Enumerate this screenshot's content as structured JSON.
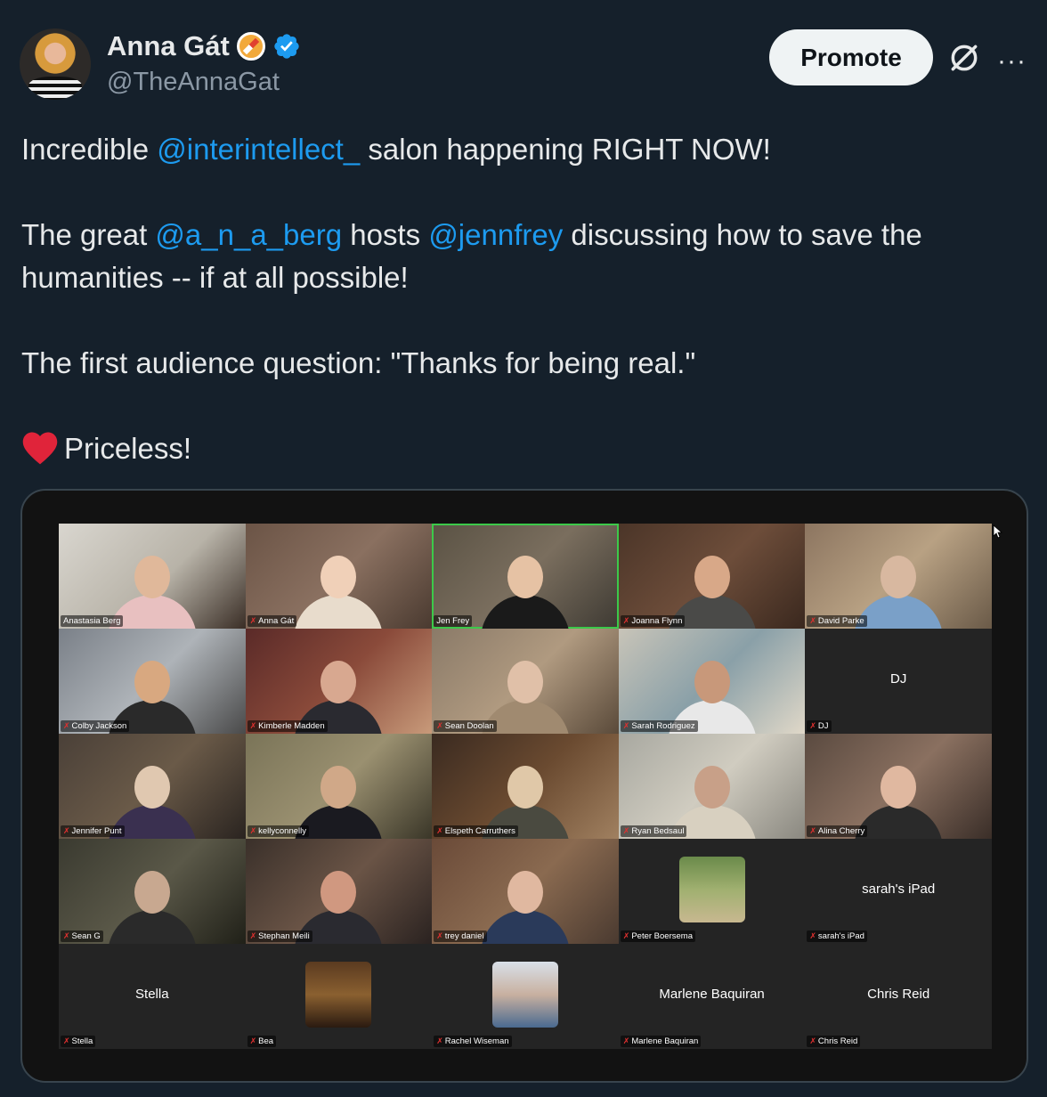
{
  "author": {
    "name": "Anna Gát",
    "handle": "@TheAnnaGat"
  },
  "header": {
    "promote_label": "Promote",
    "grok_icon": "grok-icon",
    "more_icon": "more-icon"
  },
  "tweet": {
    "line1_pre": "Incredible ",
    "mention1": "@interintellect_",
    "line1_post": " salon happening RIGHT NOW!",
    "line2_pre": "The great ",
    "mention2": "@a_n_a_berg",
    "line2_mid": " hosts ",
    "mention3": "@jennfrey",
    "line2_post": " discussing how to save the humanities -- if at all possible!",
    "line3": "The first audience question: \"Thanks for being real.\"",
    "line4": "Priceless!",
    "emoji": "red-heart"
  },
  "colors": {
    "background": "#15202b",
    "text": "#e7e9ea",
    "secondary": "#8b98a5",
    "mention": "#1d9bf0",
    "active_speaker": "#3cc94a"
  },
  "video_call": {
    "tiles": [
      {
        "label": "Anastasia Berg",
        "muted": false,
        "video": true
      },
      {
        "label": "Anna Gát",
        "muted": true,
        "video": true
      },
      {
        "label": "Jen Frey",
        "muted": false,
        "video": true,
        "active": true
      },
      {
        "label": "Joanna Flynn",
        "muted": true,
        "video": true
      },
      {
        "label": "David Parke",
        "muted": true,
        "video": true
      },
      {
        "label": "Colby Jackson",
        "muted": true,
        "video": true
      },
      {
        "label": "Kimberle Madden",
        "muted": true,
        "video": true
      },
      {
        "label": "Sean Doolan",
        "muted": true,
        "video": true
      },
      {
        "label": "Sarah Rodriguez",
        "muted": true,
        "video": true
      },
      {
        "label": "DJ",
        "muted": true,
        "video": false,
        "display_name": "DJ"
      },
      {
        "label": "Jennifer Punt",
        "muted": true,
        "video": true
      },
      {
        "label": "kellyconnelly",
        "muted": true,
        "video": true
      },
      {
        "label": "Elspeth Carruthers",
        "muted": true,
        "video": true
      },
      {
        "label": "Ryan Bedsaul",
        "muted": true,
        "video": true
      },
      {
        "label": "Alina Cherry",
        "muted": true,
        "video": true
      },
      {
        "label": "Sean G",
        "muted": true,
        "video": true
      },
      {
        "label": "Stephan Meili",
        "muted": true,
        "video": true
      },
      {
        "label": "trey daniel",
        "muted": true,
        "video": true
      },
      {
        "label": "Peter Boersema",
        "muted": true,
        "video": false,
        "thumbnail": true
      },
      {
        "label": "sarah's iPad",
        "muted": true,
        "video": false,
        "display_name": "sarah's iPad"
      },
      {
        "label": "Stella",
        "muted": true,
        "video": false,
        "display_name": "Stella"
      },
      {
        "label": "Bea",
        "muted": true,
        "video": false,
        "thumbnail": true
      },
      {
        "label": "Rachel Wiseman",
        "muted": true,
        "video": false,
        "thumbnail": true
      },
      {
        "label": "Marlene Baquiran",
        "muted": true,
        "video": false,
        "display_name": "Marlene Baquiran"
      },
      {
        "label": "Chris Reid",
        "muted": true,
        "video": false,
        "display_name": "Chris Reid"
      }
    ]
  }
}
